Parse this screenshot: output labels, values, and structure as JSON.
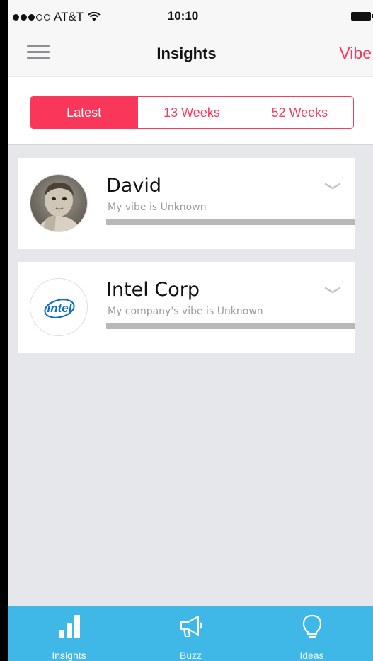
{
  "status_bar": {
    "carrier": "AT&T",
    "time": "10:10",
    "signal_icon": "signal-dots-icon",
    "wifi_icon": "wifi-icon",
    "battery_icon": "battery-icon"
  },
  "nav": {
    "title": "Insights",
    "right_label": "Vibe",
    "menu_icon": "hamburger-menu-icon"
  },
  "segments": [
    {
      "label": "Latest",
      "selected": true
    },
    {
      "label": "13 Weeks",
      "selected": false
    },
    {
      "label": "52 Weeks",
      "selected": false
    }
  ],
  "cards": [
    {
      "name": "David",
      "subtitle": "My vibe is Unknown",
      "avatar": "person-photo"
    },
    {
      "name": "Intel Corp",
      "subtitle": "My company's vibe is Unknown",
      "avatar": "intel-logo",
      "logo_text": "intel"
    }
  ],
  "tabs": [
    {
      "label": "Insights",
      "icon": "bar-chart-icon",
      "active": true
    },
    {
      "label": "Buzz",
      "icon": "megaphone-icon",
      "active": false
    },
    {
      "label": "Ideas",
      "icon": "lightbulb-icon",
      "active": false
    }
  ],
  "colors": {
    "accent": "#f9375a",
    "tab_bar": "#3fb8e8",
    "background": "#e6e7eb"
  }
}
